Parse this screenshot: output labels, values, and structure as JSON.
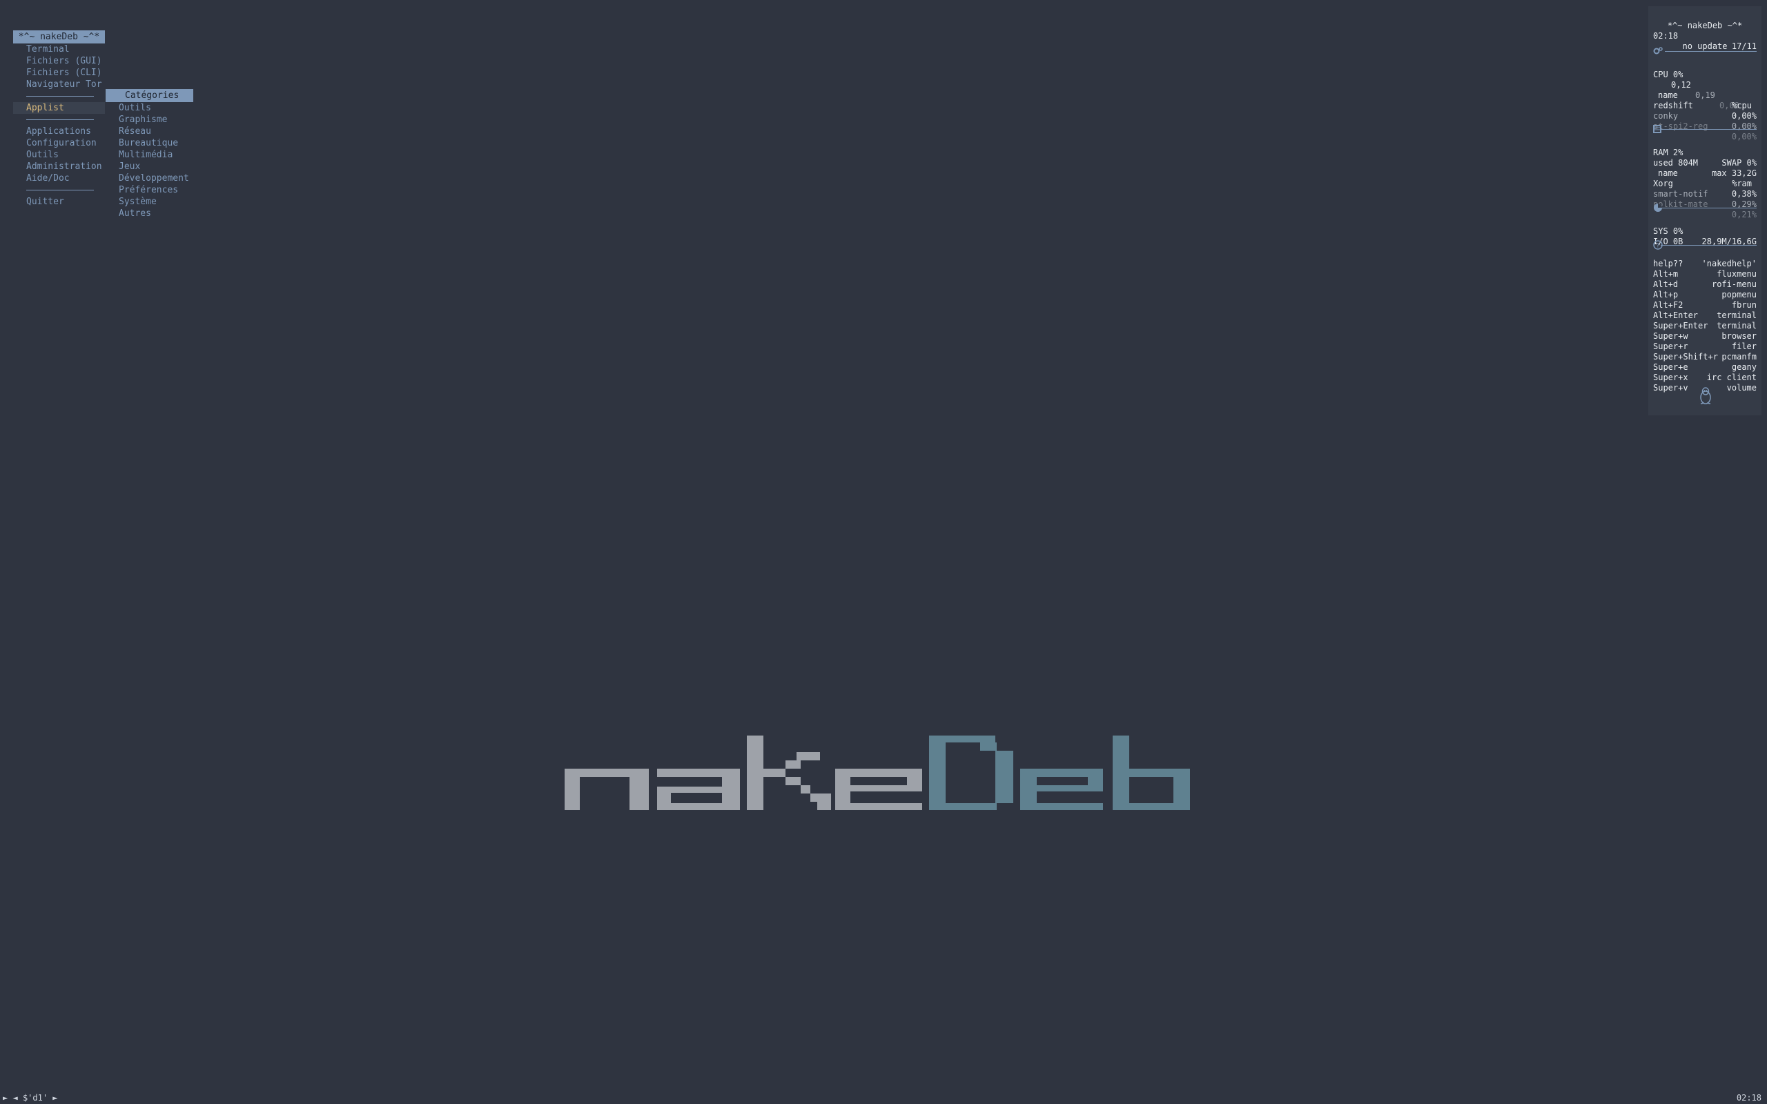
{
  "root_menu": {
    "title": "*^~ nakeDeb ~^*",
    "items_top": [
      "Terminal",
      "Fichiers (GUI)",
      "Fichiers (CLI)",
      "Navigateur Tor"
    ],
    "applist": "Applist",
    "items_mid": [
      "Applications",
      "Configuration",
      "Outils",
      "Administration",
      "Aide/Doc"
    ],
    "quit": "Quitter"
  },
  "categories_menu": {
    "title": "Catégories",
    "items": [
      "Outils",
      "Graphisme",
      "Réseau",
      "Bureautique",
      "Multimédia",
      "Jeux",
      "Développement",
      "Préférences",
      "Système",
      "Autres"
    ]
  },
  "logo": {
    "part1": "nake",
    "part2": "Deb",
    "color1": "#9ea2a9",
    "color2": "#5f8190"
  },
  "conky": {
    "title": "*^~ nakeDeb ~^*",
    "time": "02:18",
    "date": "17/11",
    "update": "no update",
    "cpu_label": "CPU 0%",
    "load": [
      "0,12",
      "0,19",
      "0,08"
    ],
    "proc_header": {
      "name": "name",
      "value": "%cpu"
    },
    "cpu_procs": [
      {
        "name": "redshift",
        "value": "0,00%"
      },
      {
        "name": "conky",
        "value": "0,00%"
      },
      {
        "name": "at-spi2-reg",
        "value": "0,00%"
      }
    ],
    "ram_label": "RAM 2%",
    "swap_label": "SWAP 0%",
    "used": "used 804M",
    "max": "max 33,2G",
    "ram_header": {
      "name": "name",
      "value": "%ram"
    },
    "ram_procs": [
      {
        "name": "Xorg",
        "value": "0,38%"
      },
      {
        "name": "smart-notif",
        "value": "0,29%"
      },
      {
        "name": "polkit-mate",
        "value": "0,21%"
      }
    ],
    "sys_label": "SYS 0%",
    "disk": "28,9M/16,6G",
    "io": "I/O 0B",
    "shortcuts": [
      {
        "key": "help??",
        "action": "'nakedhelp'"
      },
      {
        "key": "Alt+m",
        "action": "fluxmenu"
      },
      {
        "key": "Alt+d",
        "action": "rofi-menu"
      },
      {
        "key": "Alt+p",
        "action": "popmenu"
      },
      {
        "key": "Alt+F2",
        "action": "fbrun"
      },
      {
        "key": "Alt+Enter",
        "action": "terminal"
      },
      {
        "key": "Super+Enter",
        "action": "terminal"
      },
      {
        "key": "Super+w",
        "action": "browser"
      },
      {
        "key": "Super+r",
        "action": "filer"
      },
      {
        "key": "Super+Shift+r",
        "action": "pcmanfm"
      },
      {
        "key": "Super+e",
        "action": "geany"
      },
      {
        "key": "Super+x",
        "action": "irc client"
      },
      {
        "key": "Super+v",
        "action": "volume"
      }
    ],
    "accent": "#7e98b8"
  },
  "bottom_bar": {
    "left_arrow": "►",
    "workspace_prev": "◄",
    "workspace": "$'d1'",
    "workspace_next": "►",
    "clock": "02:18"
  }
}
